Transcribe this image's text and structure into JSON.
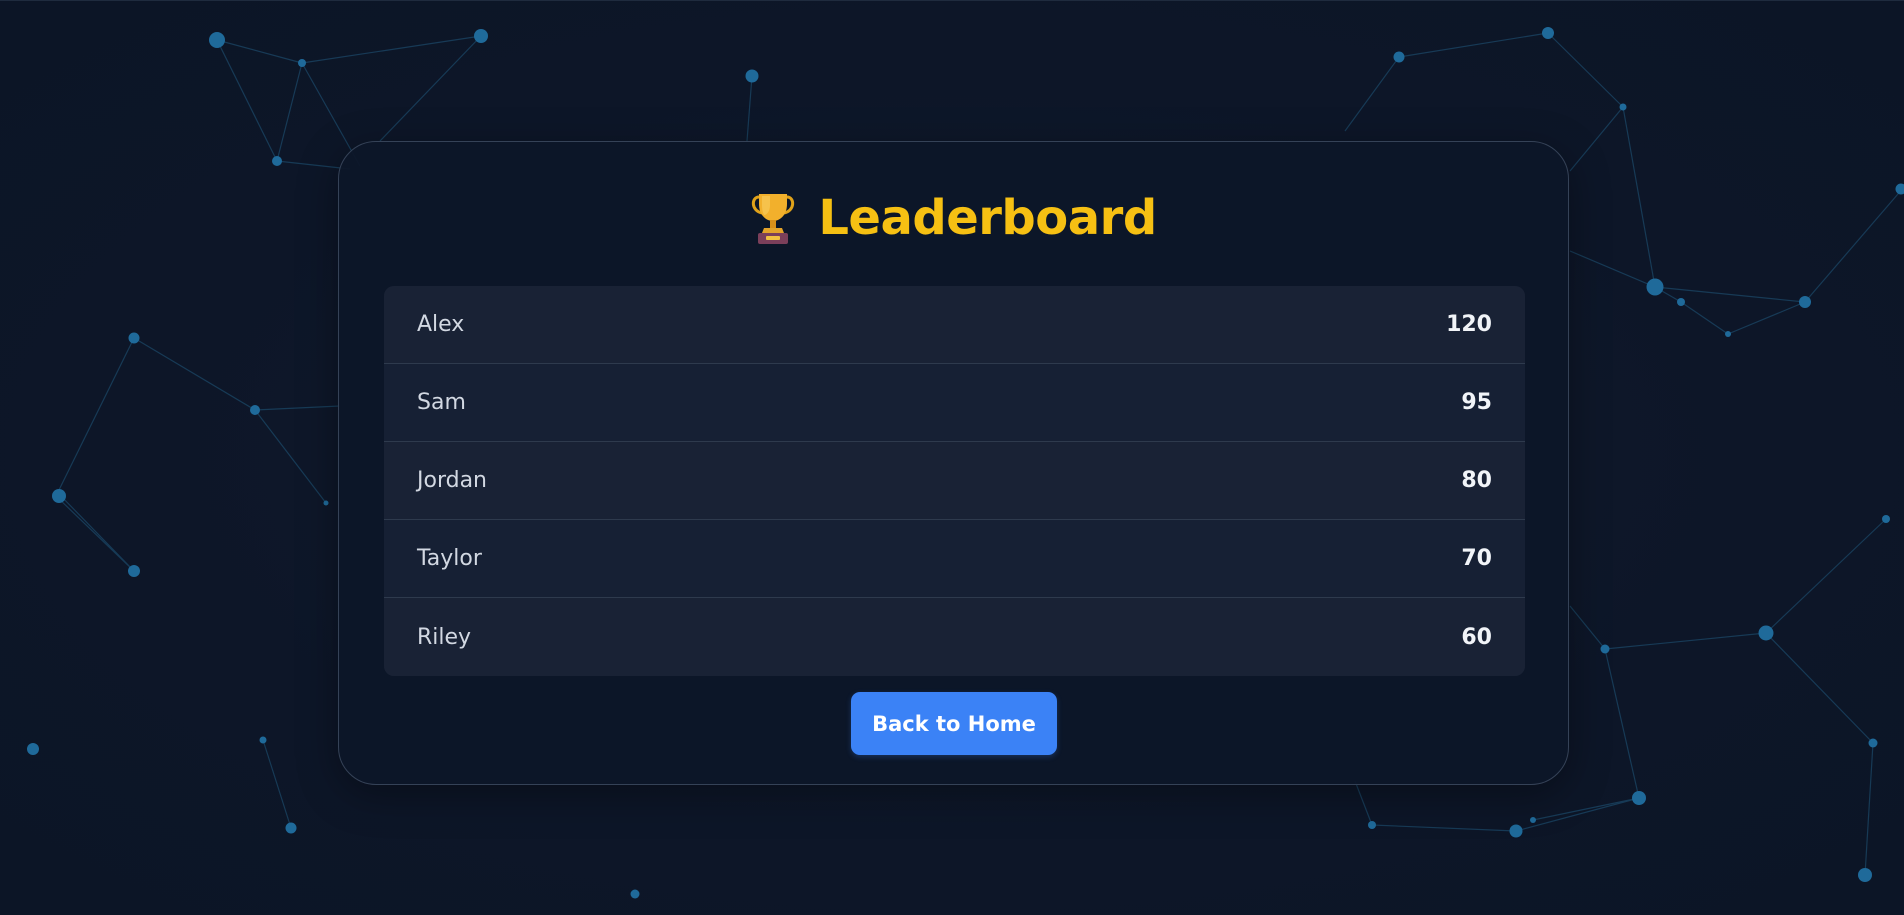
{
  "title": {
    "icon": "trophy-icon",
    "text": "Leaderboard"
  },
  "leaderboard": {
    "rows": [
      {
        "name": "Alex",
        "score": "120"
      },
      {
        "name": "Sam",
        "score": "95"
      },
      {
        "name": "Jordan",
        "score": "80"
      },
      {
        "name": "Taylor",
        "score": "70"
      },
      {
        "name": "Riley",
        "score": "60"
      }
    ]
  },
  "actions": {
    "back_label": "Back to Home"
  },
  "colors": {
    "background": "#0e1729",
    "accent_title": "#f6c013",
    "button": "#3b82f6",
    "network_nodes": "#1f6a9a"
  }
}
